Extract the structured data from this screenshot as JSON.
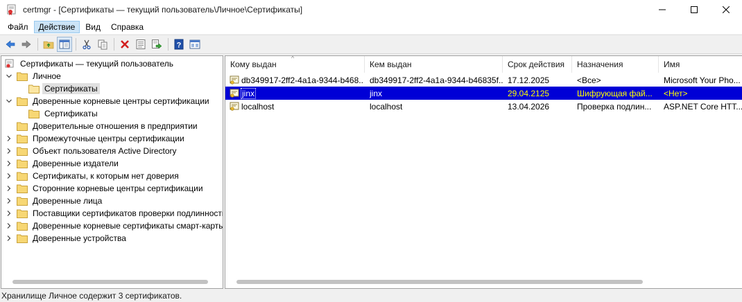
{
  "window": {
    "title": "certmgr - [Сертификаты — текущий пользователь\\Личное\\Сертификаты]",
    "icon": "certmgr-icon"
  },
  "menu": {
    "items": [
      "Файл",
      "Действие",
      "Вид",
      "Справка"
    ],
    "active": "Действие"
  },
  "toolbar": {
    "buttons": [
      "back-icon",
      "forward-icon",
      "up-folder-icon",
      "show-tree-icon",
      "cut-icon",
      "copy-icon",
      "delete-icon",
      "properties-icon",
      "export-icon",
      "help-icon",
      "view-icon"
    ]
  },
  "tree": {
    "root": "Сертификаты — текущий пользователь",
    "items": [
      {
        "label": "Личное",
        "expanded": true
      },
      {
        "label": "Сертификаты",
        "selected": true
      },
      {
        "label": "Доверенные корневые центры сертификации",
        "expanded": true
      },
      {
        "label": "Сертификаты"
      },
      {
        "label": "Доверительные отношения в предприятии"
      },
      {
        "label": "Промежуточные центры сертификации"
      },
      {
        "label": "Объект пользователя Active Directory"
      },
      {
        "label": "Доверенные издатели"
      },
      {
        "label": "Сертификаты, к которым нет доверия"
      },
      {
        "label": "Сторонние корневые центры сертификации"
      },
      {
        "label": "Доверенные лица"
      },
      {
        "label": "Поставщики сертификатов проверки подлинности"
      },
      {
        "label": "Доверенные корневые сертификаты смарт-карты"
      },
      {
        "label": "Доверенные устройства"
      }
    ]
  },
  "list": {
    "columns": [
      "Кому выдан",
      "Кем выдан",
      "Срок действия",
      "Назначения",
      "Имя"
    ],
    "rows": [
      {
        "issued_to": "db349917-2ff2-4a1a-9344-b468...",
        "issued_by": "db349917-2ff2-4a1a-9344-b46835f...",
        "expires": "17.12.2025",
        "purposes": "<Все>",
        "name": "Microsoft Your Pho..."
      },
      {
        "issued_to": "jinx",
        "issued_by": "jinx",
        "expires": "29.04.2125",
        "purposes": "Шифрующая фай...",
        "name": "<Нет>",
        "selected": true
      },
      {
        "issued_to": "localhost",
        "issued_by": "localhost",
        "expires": "13.04.2026",
        "purposes": "Проверка подлин...",
        "name": "ASP.NET Core HTT..."
      }
    ]
  },
  "status": {
    "text": "Хранилище Личное содержит 3 сертификатов."
  },
  "colors": {
    "selection": "#0000d6",
    "selected_text_highlight": "#ffff00"
  }
}
